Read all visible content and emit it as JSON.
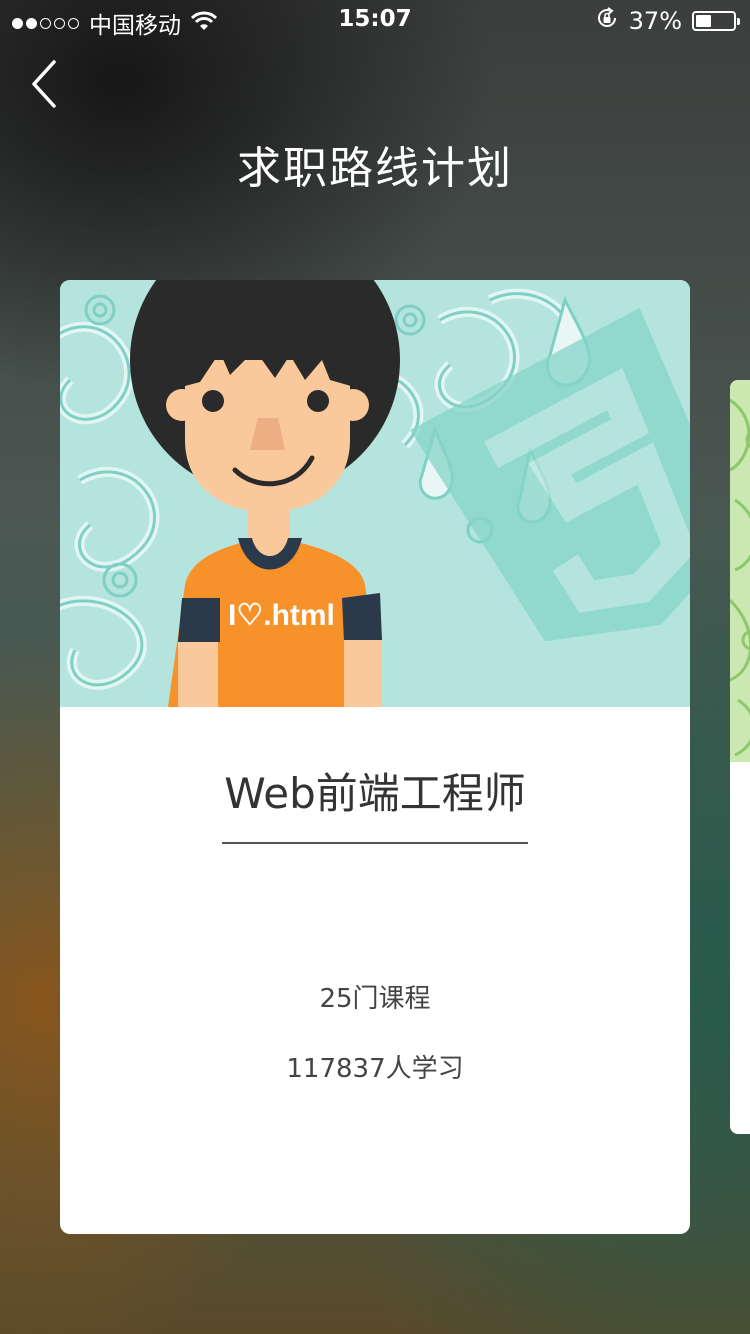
{
  "status_bar": {
    "carrier": "中国移动",
    "time": "15:07",
    "battery_percent": "37%",
    "battery_level": 0.37,
    "signal_bars_filled": 2,
    "signal_bars_total": 5
  },
  "header": {
    "back_icon": "chevron-left-icon",
    "title": "求职路线计划"
  },
  "card": {
    "shirt_text": "I♡.html",
    "title": "Web前端工程师",
    "courses": "25门课程",
    "learners": "117837人学习",
    "colors": {
      "illustration_bg": "#b5e4df",
      "pattern": "#7fd0c4",
      "shirt": "#f7922a",
      "sleeves": "#2b3a4a",
      "skin": "#f9c89b",
      "hair": "#2a2a2a"
    }
  },
  "next_card": {
    "colors": {
      "illustration_bg": "#cbe7b2",
      "pattern": "#8cc86a"
    }
  }
}
